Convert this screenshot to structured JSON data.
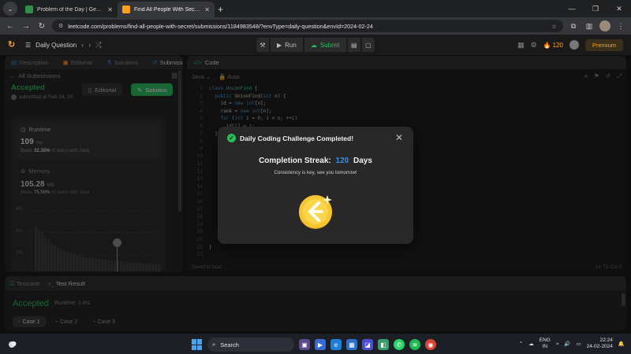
{
  "browser": {
    "tabs": [
      {
        "title": "Problem of the Day | GeeksforG",
        "favicon_color": "#2f8d46"
      },
      {
        "title": "Find All People With Secret - Le",
        "favicon_color": "#ffa116"
      }
    ],
    "url": "leetcode.com/problems/find-all-people-with-secret/submissions/1184983548/?envType=daily-question&envId=2024-02-24"
  },
  "nav": {
    "title": "Daily Question",
    "run": "Run",
    "submit": "Submit",
    "streak": "120",
    "premium": "Premium"
  },
  "left": {
    "tabs": [
      "Description",
      "Editorial",
      "Solutions",
      "Submissions"
    ],
    "all_submissions": "All Submissions",
    "status": "Accepted",
    "submitted": "submitted at Feb 24, 20",
    "editorial_btn": "Editorial",
    "solution_btn": "Solution",
    "runtime_label": "Runtime",
    "runtime_value": "109",
    "runtime_unit": "ms",
    "runtime_beats_pre": "Beats",
    "runtime_beats_pct": "32.35%",
    "runtime_beats_post": "of users with Java",
    "memory_label": "Memory",
    "memory_value": "105.28",
    "memory_unit": "MB",
    "memory_beats_pre": "Beats",
    "memory_beats_pct": "75.50%",
    "memory_beats_post": "of users with Java",
    "grid_labels": [
      "6%",
      "4%",
      "2%"
    ]
  },
  "right": {
    "title": "Code",
    "language": "Java",
    "mode": "Auto",
    "lines": [
      "1",
      "2",
      "3",
      "4",
      "5",
      "6",
      "7",
      "8",
      "9",
      "10",
      "11",
      "12",
      "13",
      "14",
      "15",
      "16",
      "17",
      "18",
      "19",
      "20",
      "21",
      "22",
      "23"
    ],
    "saved": "Saved to local",
    "cursor": "Ln 73, Col 2"
  },
  "bottom": {
    "testcase_tab": "Testcase",
    "result_tab": "Test Result",
    "status": "Accepted",
    "runtime": "Runtime: 1 ms",
    "cases": [
      "Case 1",
      "Case 2",
      "Case 3"
    ]
  },
  "modal": {
    "title": "Daily Coding Challenge Completed!",
    "streak_label": "Completion Streak:",
    "streak_value": "120",
    "streak_unit": "Days",
    "subtitle": "Consistency is key, see you tomorrow!"
  },
  "taskbar": {
    "search": "Search",
    "lang_top": "ENG",
    "lang_bottom": "IN",
    "time": "22:24",
    "date": "24-02-2024"
  }
}
